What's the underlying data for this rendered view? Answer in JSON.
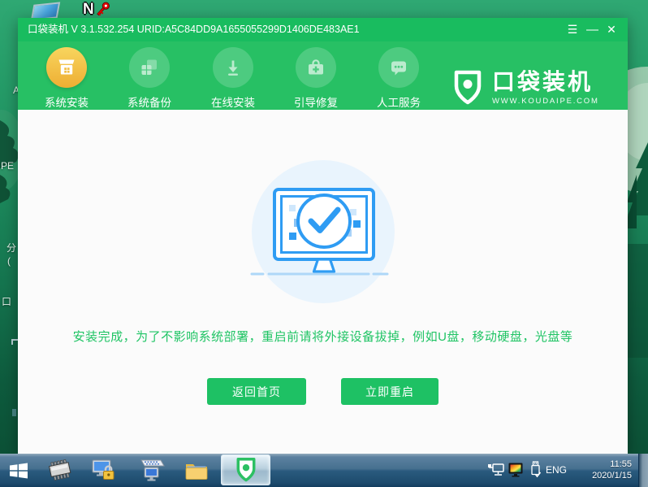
{
  "desktop": {
    "n_label": "N",
    "edge": {
      "a": "A",
      "pe": "PE",
      "fen": "分",
      "paren": "(",
      "kou": "口"
    }
  },
  "window": {
    "title": "口袋装机 V 3.1.532.254 URID:A5C84DD9A1655055299D1406DE483AE1",
    "controls": {
      "menu": "☰",
      "minimize": "—",
      "close": "✕"
    },
    "nav": [
      {
        "label": "系统安装",
        "active": true
      },
      {
        "label": "系统备份",
        "active": false
      },
      {
        "label": "在线安装",
        "active": false
      },
      {
        "label": "引导修复",
        "active": false
      },
      {
        "label": "人工服务",
        "active": false
      }
    ],
    "logo": {
      "name": "口袋装机",
      "site": "WWW.KOUDAIPE.COM"
    },
    "message": "安装完成，为了不影响系统部署，重启前请将外接设备拔掉，例如U盘，移动硬盘，光盘等",
    "buttons": {
      "home": "返回首页",
      "restart": "立即重启"
    }
  },
  "taskbar": {
    "language": "ENG",
    "time": "11:55",
    "date": "2020/1/15"
  },
  "colors": {
    "titlebar_green": "#19bc5f",
    "nav_green": "#27c064",
    "accent_green": "#1ec164",
    "active_circle_yellow": "#f0b93f",
    "illustration_blue": "#2f9cf3",
    "illustration_bg": "#e9f4fd",
    "content_bg": "#fbfbfb",
    "taskbar_blue": "#2a5a7e"
  }
}
